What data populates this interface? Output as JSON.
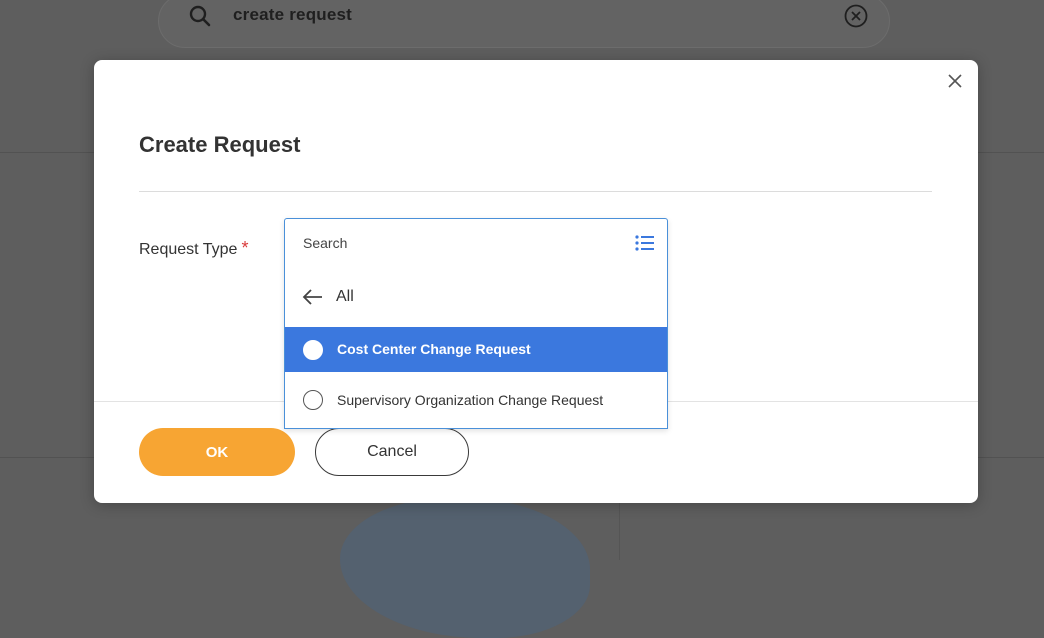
{
  "background": {
    "search_text": "create request",
    "icons": {
      "search": "search-icon",
      "clear": "clear-circle-icon"
    }
  },
  "modal": {
    "title": "Create Request",
    "field": {
      "label": "Request Type",
      "required_mark": "*"
    },
    "dropdown": {
      "search_placeholder": "Search",
      "back_label": "All",
      "options": [
        {
          "label": "Cost Center Change Request",
          "selected": true
        },
        {
          "label": "Supervisory Organization Change Request",
          "selected": false
        }
      ],
      "icons": {
        "list": "list-icon",
        "back": "arrow-left-icon"
      }
    },
    "buttons": {
      "ok": "OK",
      "cancel": "Cancel"
    },
    "close_icon": "close-icon"
  },
  "colors": {
    "accent_orange": "#f7a533",
    "selection_blue": "#3b78de",
    "focus_border": "#4a90d9",
    "required_red": "#d93a3a",
    "overlay": "#5e5e5e"
  }
}
